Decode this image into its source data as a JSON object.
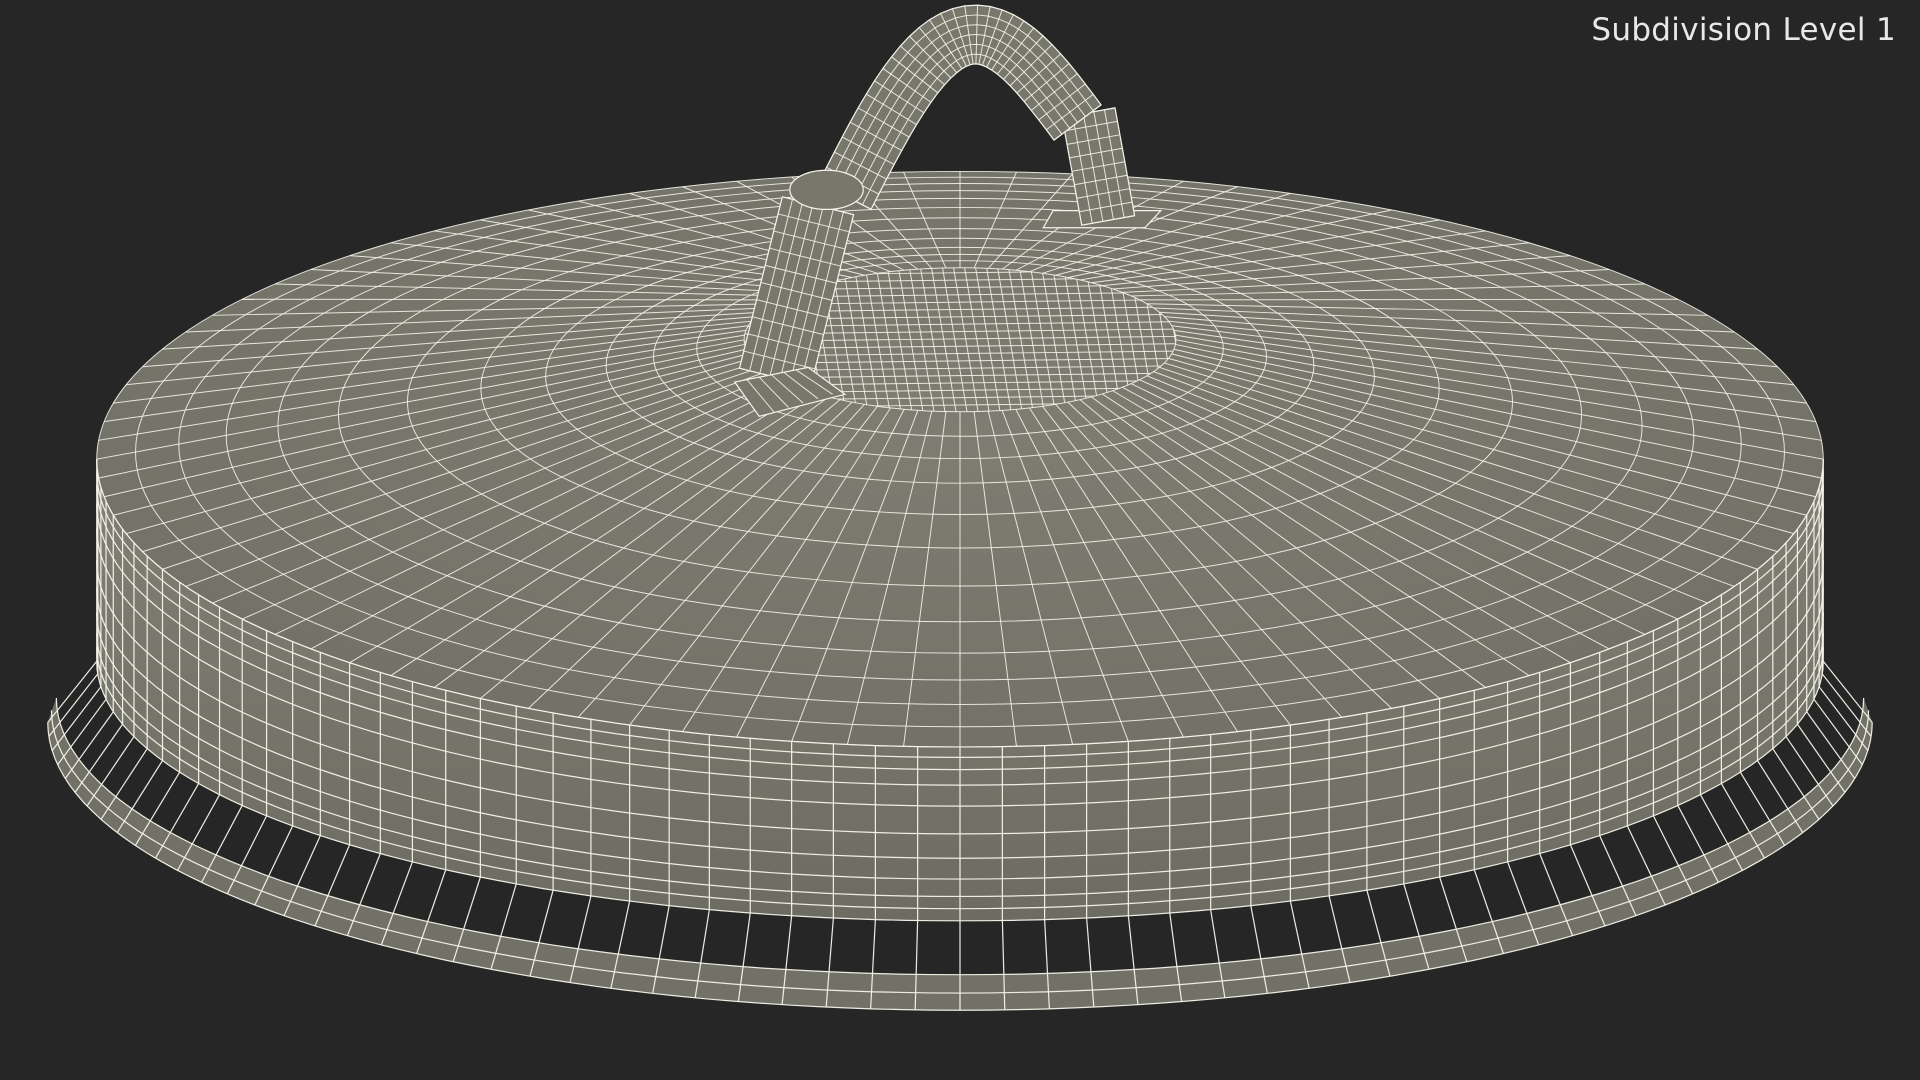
{
  "viewport": {
    "subdivision_label": "Subdivision Level 1",
    "background_color": "#262626",
    "surface_color": "#77776c",
    "wire_color": "#f4f4ea"
  }
}
